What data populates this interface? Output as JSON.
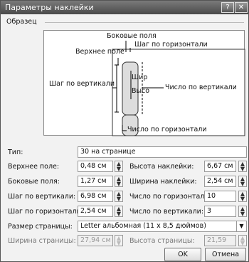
{
  "window": {
    "title": "Параметры наклейки",
    "help_label": "?",
    "close_label": "✕"
  },
  "sample": {
    "group_label": "Образец",
    "side_margins": "Боковые поля",
    "top_margin": "Верхнее поле",
    "horizontal_pitch": "Шаг по горизонтали",
    "vertical_pitch": "Шаг по вертикали",
    "width_short": "Шир",
    "height_short": "Высо",
    "number_down": "Число по вертикали",
    "number_across": "Число по горизонтали"
  },
  "form": {
    "type_label": "Тип:",
    "type_value": "30 на странице",
    "top_margin_label": "Верхнее поле:",
    "top_margin_value": "0,48 см",
    "label_height_label": "Высота наклейки:",
    "label_height_value": "6,67 см",
    "side_margin_label": "Боковые поля:",
    "side_margin_value": "1,27 см",
    "label_width_label": "Ширина наклейки:",
    "label_width_value": "2,54 см",
    "vertical_pitch_label": "Шаг по вертикали:",
    "vertical_pitch_value": "6,98 см",
    "number_across_label": "Число по горизонтали:",
    "number_across_value": "10",
    "horizontal_pitch_label": "Шаг по горизонтали:",
    "horizontal_pitch_value": "2,54 см",
    "number_down_label": "Число по вертикали:",
    "number_down_value": "3",
    "page_size_label": "Размер страницы:",
    "page_size_value": "Letter альбомная (11 x 8,5 дюймов)",
    "page_width_label": "Ширина страницы:",
    "page_width_value": "27,94 см",
    "page_height_label": "Высота страницы:",
    "page_height_value": "21,59 см"
  },
  "buttons": {
    "ok": "OK",
    "cancel": "Отмена"
  }
}
